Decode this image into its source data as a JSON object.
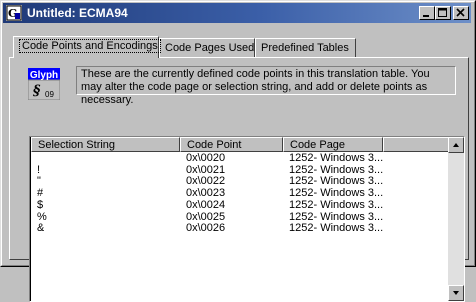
{
  "window": {
    "title": "Untitled: ECMA94"
  },
  "tabs": [
    {
      "label": "Code Points and Encodings",
      "active": true
    },
    {
      "label": "Code Pages Used",
      "active": false
    },
    {
      "label": "Predefined Tables",
      "active": false
    }
  ],
  "glyph_icon": {
    "label": "Glyph",
    "sample": "09"
  },
  "description": "These are the currently defined code points in this translation table.  You may alter the code page or selection string, and add or delete points as necessary.",
  "table": {
    "columns": [
      "Selection String",
      "Code Point",
      "Code Page"
    ],
    "rows": [
      [
        "",
        "0x\\0020",
        "1252- Windows 3..."
      ],
      [
        "!",
        "0x\\0021",
        "1252- Windows 3..."
      ],
      [
        "\"",
        "0x\\0022",
        "1252- Windows 3..."
      ],
      [
        "#",
        "0x\\0023",
        "1252- Windows 3..."
      ],
      [
        "$",
        "0x\\0024",
        "1252- Windows 3..."
      ],
      [
        "%",
        "0x\\0025",
        "1252- Windows 3..."
      ],
      [
        "&",
        "0x\\0026",
        "1252- Windows 3..."
      ]
    ]
  },
  "colors": {
    "titlebar_start": "#1f3a78",
    "titlebar_end": "#6d8fc8",
    "face": "#c0c0c0"
  }
}
